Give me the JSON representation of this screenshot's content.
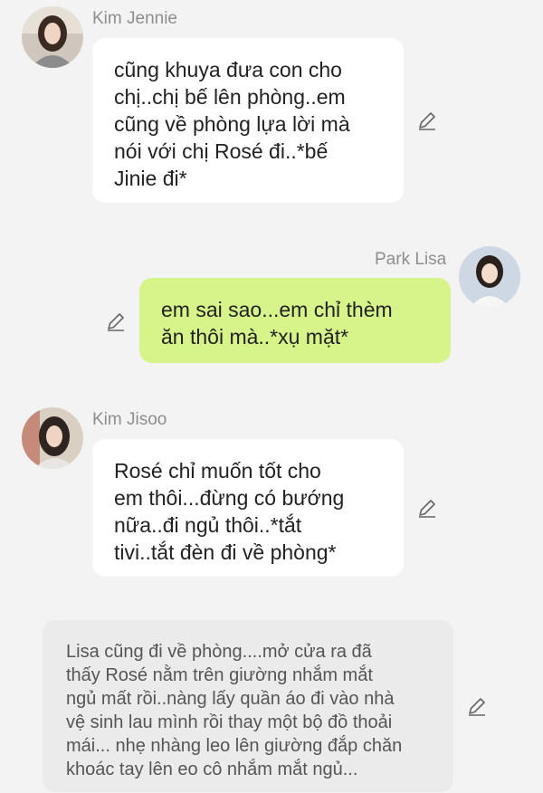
{
  "messages": [
    {
      "sender": "Kim Jennie",
      "side": "left",
      "lines": [
        "cũng khuya đưa con cho",
        "chị..chị bế lên phòng..em",
        "cũng về phòng lựa lời mà",
        "nói với chị Rosé đi..*bế",
        "Jinie đi*"
      ]
    },
    {
      "sender": "Park Lisa",
      "side": "right",
      "lines": [
        "em sai sao...em chỉ thèm",
        "ăn thôi mà..*xụ mặt*"
      ]
    },
    {
      "sender": "Kim Jisoo",
      "side": "left",
      "lines": [
        "Rosé chỉ muốn tốt cho",
        "em thôi...đừng có bướng",
        "nữa..đi ngủ thôi..*tắt",
        "tivi..tắt đèn đi về phòng*"
      ]
    },
    {
      "sender": "",
      "side": "narration",
      "lines": [
        "Lisa cũng đi về phòng....mở cửa ra đã",
        "thấy Rosé nằm trên giường nhắm mắt",
        "ngủ mất rồi..nàng lấy quần áo đi vào nhà",
        "vệ sinh lau mình rồi thay một bộ đồ thoải",
        "mái... nhẹ nhàng leo lên giường đắp chăn",
        "khoác tay lên eo cô nhắm mắt ngủ..."
      ]
    }
  ],
  "colors": {
    "background": "#f3f3f3",
    "bubble_white": "#ffffff",
    "bubble_green": "#d7f48a",
    "bubble_gray": "#ebebeb",
    "name_gray": "#8e8e8e"
  },
  "icons": [
    "avatar",
    "pencil-edit-icon"
  ]
}
